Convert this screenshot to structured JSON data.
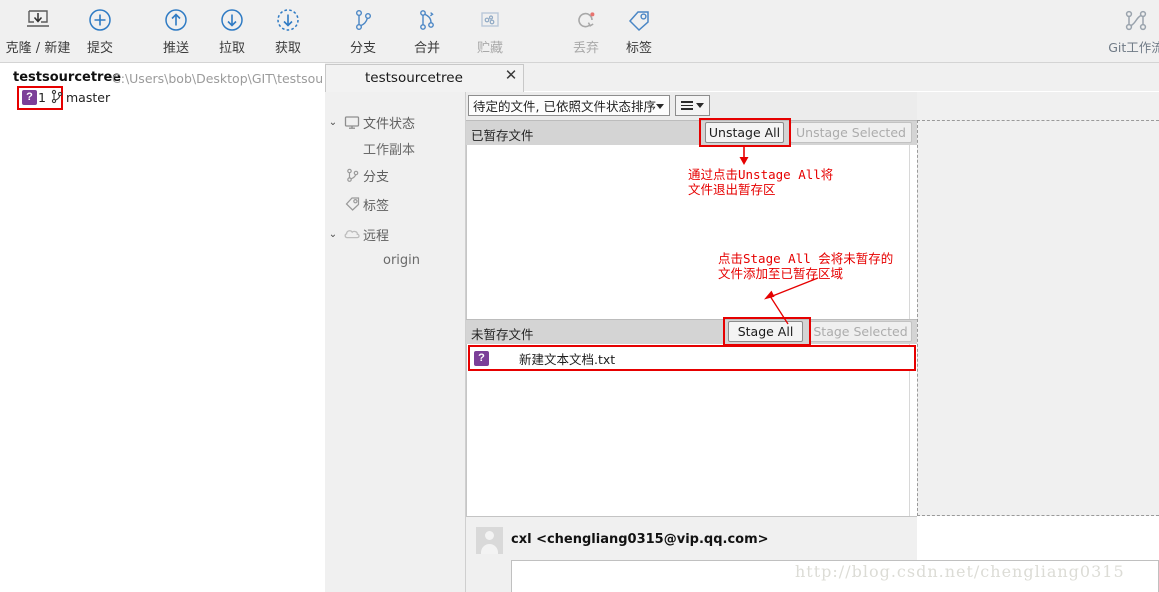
{
  "toolbar": {
    "items": [
      {
        "label": "克隆 / 新建",
        "icon": "clone-download-icon",
        "enabled": true
      },
      {
        "label": "提交",
        "icon": "commit-plus-icon",
        "enabled": true
      },
      {
        "label": "推送",
        "icon": "push-up-arrow-icon",
        "enabled": true
      },
      {
        "label": "拉取",
        "icon": "pull-down-arrow-icon",
        "enabled": true
      },
      {
        "label": "获取",
        "icon": "fetch-dashed-arrow-icon",
        "enabled": true
      },
      {
        "label": "分支",
        "icon": "branch-icon",
        "enabled": true
      },
      {
        "label": "合并",
        "icon": "merge-icon",
        "enabled": true
      },
      {
        "label": "贮藏",
        "icon": "stash-icon",
        "enabled": false
      },
      {
        "label": "丢弃",
        "icon": "discard-refresh-icon",
        "enabled": false
      },
      {
        "label": "标签",
        "icon": "tag-icon",
        "enabled": true
      }
    ],
    "right_item": {
      "label": "Git工作流",
      "icon": "git-flow-icon"
    }
  },
  "repo_header": {
    "name": "testsourcetree",
    "path": "C:\\Users\\bob\\Desktop\\GIT\\testsourc",
    "badge_glyph": "?",
    "badge_count": "1",
    "branch": "master",
    "branch_icon": "branch-icon"
  },
  "tab": {
    "label": "testsourcetree",
    "close_glyph": "✕"
  },
  "sidebar": {
    "items": [
      {
        "label": "文件状态",
        "icon": "monitor-icon",
        "chevron": "⌄",
        "indent": 0
      },
      {
        "label": "工作副本",
        "icon": "",
        "chevron": "",
        "indent": 1
      },
      {
        "label": "分支",
        "icon": "branch-icon",
        "chevron": "",
        "indent": 0
      },
      {
        "label": "标签",
        "icon": "tag-icon",
        "chevron": "",
        "indent": 0
      },
      {
        "label": "远程",
        "icon": "cloud-icon",
        "chevron": "⌄",
        "indent": 0
      },
      {
        "label": "origin",
        "icon": "",
        "chevron": "",
        "indent": 1
      }
    ]
  },
  "filter_bar": {
    "selected": "待定的文件, 已依照文件状态排序",
    "dropdown_icon": "chevron-down-icon",
    "menu_icon": "hamburger-menu-icon"
  },
  "staged": {
    "title": "已暂存文件",
    "unstage_all_label": "Unstage All",
    "unstage_selected_label": "Unstage Selected",
    "unstage_selected_enabled": false,
    "files": []
  },
  "unstaged": {
    "title": "未暂存文件",
    "stage_all_label": "Stage All",
    "stage_selected_label": "Stage Selected",
    "stage_selected_enabled": false,
    "files": [
      {
        "name": "新建文本文档.txt",
        "status_glyph": "?",
        "status": "untracked"
      }
    ]
  },
  "annotations": [
    {
      "text": "通过点击Unstage All将\n文件退出暂存区",
      "color": "#e60000"
    },
    {
      "text": "点击Stage All 会将未暂存的\n文件添加至已暂存区域",
      "color": "#e60000"
    }
  ],
  "commit_area": {
    "author": "cxl <chengliang0315@vip.qq.com>",
    "avatar_icon": "user-avatar-icon",
    "message_value": "",
    "message_placeholder": ""
  },
  "watermark": "http://blog.csdn.net/chengliang0315",
  "colors": {
    "accent": "#2b6cb0",
    "highlight_red": "#e60000",
    "status_purple": "#7b3f98",
    "toolbar_bg": "#f0f0f0",
    "section_header_bg": "#d4d4d4"
  }
}
